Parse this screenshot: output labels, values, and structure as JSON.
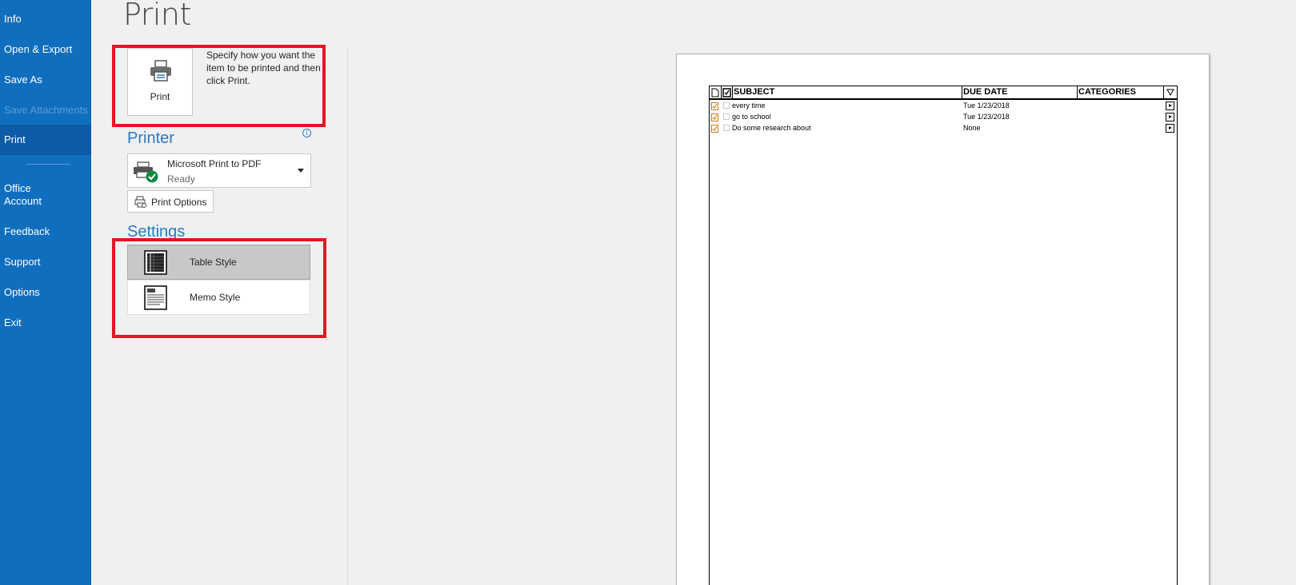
{
  "sidebar": {
    "items": [
      {
        "label": "Info"
      },
      {
        "label": "Open & Export"
      },
      {
        "label": "Save As"
      },
      {
        "label": "Save Attachments"
      },
      {
        "label": "Print"
      },
      {
        "label": "Office\nAccount"
      },
      {
        "label": "Feedback"
      },
      {
        "label": "Support"
      },
      {
        "label": "Options"
      },
      {
        "label": "Exit"
      }
    ],
    "selected": "Print",
    "disabled": "Save Attachments"
  },
  "page_title": "Print",
  "print_button": {
    "label": "Print",
    "description": "Specify how you want the item to be printed and then click Print."
  },
  "printer": {
    "section_title": "Printer",
    "name": "Microsoft Print to PDF",
    "status": "Ready",
    "options_label": "Print Options"
  },
  "settings": {
    "section_title": "Settings",
    "styles": [
      {
        "label": "Table Style",
        "selected": true
      },
      {
        "label": "Memo Style",
        "selected": false
      }
    ]
  },
  "preview": {
    "columns": [
      "SUBJECT",
      "DUE DATE",
      "CATEGORIES"
    ],
    "rows": [
      {
        "subject": "every time",
        "due_date": "Tue 1/23/2018"
      },
      {
        "subject": "go to school",
        "due_date": "Tue 1/23/2018"
      },
      {
        "subject": "Do some research about",
        "due_date": "None"
      }
    ]
  },
  "colors": {
    "sidebar": "#106ebe",
    "sidebar_selected": "#0d5aa7",
    "accent": "#2b79c2",
    "highlight_box": "#e81123"
  },
  "icons": {
    "printer": "printer-icon",
    "printer_ready": "printer-ready-icon",
    "print_options": "print-options-icon",
    "table_style": "table-style-icon",
    "memo_style": "memo-style-icon",
    "info": "info-icon",
    "dropdown": "chevron-down-icon"
  }
}
